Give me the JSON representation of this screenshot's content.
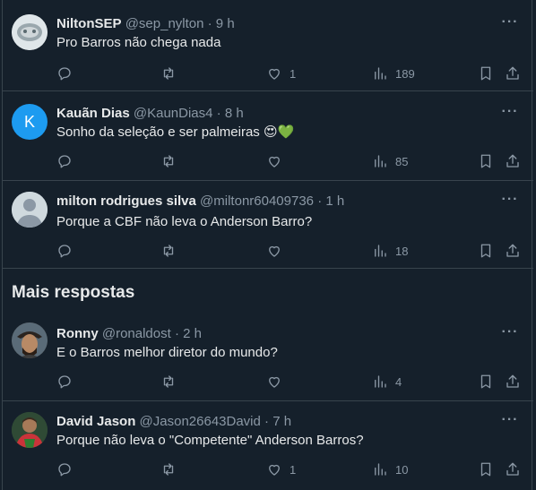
{
  "section_title": "Mais respostas",
  "tweets": [
    {
      "name": "NiltonSEP",
      "handle": "@sep_nylton",
      "time": "· 9 h",
      "text": "Pro Barros não chega nada",
      "likes": "1",
      "views": "189",
      "avatar_color": "#cfd9de"
    },
    {
      "name": "Kauãn Dias",
      "handle": "@KaunDias4",
      "time": "· 8 h",
      "text": "Sonho da seleção e ser palmeiras",
      "emoji": "😍💚",
      "likes": "",
      "views": "85",
      "avatar_letter": "K",
      "avatar_color": "#1d9bf0"
    },
    {
      "name": "milton rodrigues silva",
      "handle": "@miltonr60409736",
      "time": "· 1 h",
      "text": "Porque a CBF não leva o Anderson Barro?",
      "likes": "",
      "views": "18",
      "avatar_color": "#cfd9de"
    },
    {
      "name": "Ronny",
      "handle": "@ronaldost",
      "time": "· 2 h",
      "text": "E o Barros melhor diretor do mundo?",
      "likes": "",
      "views": "4",
      "avatar_color": "#4a3b2c"
    },
    {
      "name": "David Jason",
      "handle": "@Jason26643David",
      "time": "· 7 h",
      "text": "Porque não leva o \"Competente\" Anderson Barros?",
      "likes": "1",
      "views": "10",
      "avatar_color": "#3a5a3a"
    }
  ],
  "more_glyph": "···"
}
